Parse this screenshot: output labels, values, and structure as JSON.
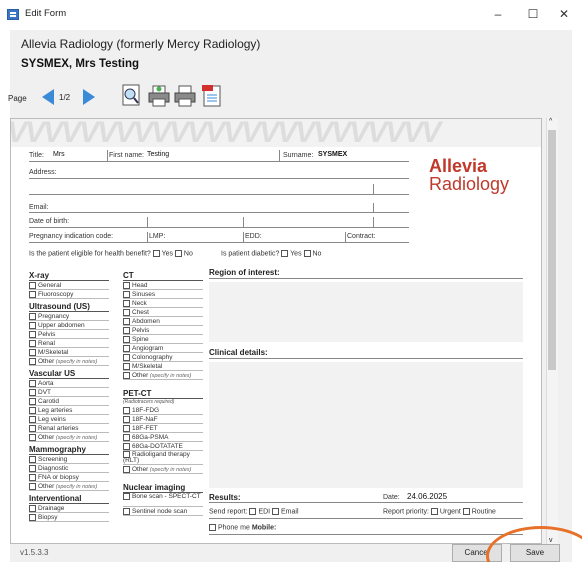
{
  "window": {
    "title": "Edit Form",
    "minimize": "–",
    "maximize": "☐",
    "close": "✕"
  },
  "org_name": "Allevia Radiology (formerly Mercy Radiology)",
  "patient_name": "SYSMEX, Mrs Testing",
  "toolbar": {
    "page_label": "Page",
    "page_num": "1/2"
  },
  "form": {
    "title_label": "Title:",
    "title_value": "Mrs",
    "firstname_label": "First name:",
    "firstname_value": "Testing",
    "surname_label": "Surname:",
    "surname_value": "SYSMEX",
    "address_label": "Address:",
    "email_label": "Email:",
    "dob_label": "Date of birth:",
    "preg_label": "Pregnancy indication code:",
    "lmp_label": "LMP:",
    "edd_label": "EDD:",
    "contract_label": "Contract:",
    "health_benefit": "Is the patient eligible for health benefit?",
    "yes": "Yes",
    "no": "No",
    "diabetic": "Is patient diabetic?",
    "logo_line1": "Allevia",
    "logo_line2": "Radiology",
    "region_label": "Region of interest:",
    "clinical_label": "Clinical details:",
    "results_label": "Results:",
    "date_label": "Date:",
    "date_value": "24.06.2025",
    "send_report": "Send report:",
    "edi": "EDI",
    "email": "Email",
    "priority": "Report priority:",
    "urgent": "Urgent",
    "routine": "Routine",
    "phone": "Phone me",
    "mobile": "Mobile:"
  },
  "col1": [
    {
      "type": "h",
      "text": "X-ray"
    },
    {
      "text": "General"
    },
    {
      "text": "Fluoroscopy"
    },
    {
      "type": "h",
      "text": "Ultrasound (US)"
    },
    {
      "text": "Pregnancy"
    },
    {
      "text": "Upper abdomen"
    },
    {
      "text": "Pelvis"
    },
    {
      "text": "Renal"
    },
    {
      "text": "M/Skeletal"
    },
    {
      "text": "Other",
      "note": "(specify in notes)"
    },
    {
      "type": "h",
      "text": "Vascular US"
    },
    {
      "text": "Aorta"
    },
    {
      "text": "DVT"
    },
    {
      "text": "Carotid"
    },
    {
      "text": "Leg arteries"
    },
    {
      "text": "Leg veins"
    },
    {
      "text": "Renal arteries"
    },
    {
      "text": "Other",
      "note": "(specify in notes)"
    },
    {
      "type": "h",
      "text": "Mammography"
    },
    {
      "text": "Screening"
    },
    {
      "text": "Diagnostic"
    },
    {
      "text": "FNA or biopsy"
    },
    {
      "text": "Other",
      "note": "(specify in notes)"
    },
    {
      "type": "h",
      "text": "Interventional"
    },
    {
      "text": "Drainage"
    },
    {
      "text": "Biopsy"
    }
  ],
  "col2": [
    {
      "type": "h",
      "text": "CT"
    },
    {
      "text": "Head"
    },
    {
      "text": "Sinuses"
    },
    {
      "text": "Neck"
    },
    {
      "text": "Chest"
    },
    {
      "text": "Abdomen"
    },
    {
      "text": "Pelvis"
    },
    {
      "text": "Spine"
    },
    {
      "text": "Angiogram"
    },
    {
      "text": "Colonography"
    },
    {
      "text": "M/Skeletal"
    },
    {
      "text": "Other",
      "note": "(specify in notes)"
    },
    {
      "type": "sp"
    },
    {
      "type": "h",
      "text": "PET-CT"
    },
    {
      "type": "n",
      "text": "(Radiotracers required)"
    },
    {
      "text": "18F-FDG"
    },
    {
      "text": "18F-NaF"
    },
    {
      "text": "18F-FET"
    },
    {
      "text": "68Ga-PSMA"
    },
    {
      "text": "68Ga-DOTATATE"
    },
    {
      "text": "Radioligand therapy (RLT)",
      "tall": true
    },
    {
      "text": "Other",
      "note": "(specify in notes)"
    },
    {
      "type": "sp"
    },
    {
      "type": "h",
      "text": "Nuclear imaging"
    },
    {
      "text": "Bone scan - SPECT-CT",
      "tall": true
    },
    {
      "text": "Sentinel node scan"
    }
  ],
  "footer": {
    "version": "v1.5.3.3",
    "cancel": "Cancel",
    "save": "Save"
  },
  "colors": {
    "accent_arrow": "#3a8ad8",
    "logo": "#c0392b",
    "highlight_circle": "#e8712a"
  }
}
